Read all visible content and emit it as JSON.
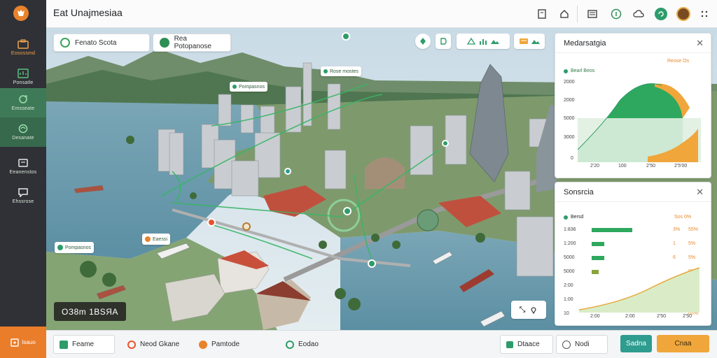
{
  "app": {
    "title": "Eat Unajmesiaa"
  },
  "sidebar": {
    "items": [
      {
        "label": "Eosossmd",
        "icon": "briefcase-icon"
      },
      {
        "label": "Ponsatle",
        "icon": "dashboard-icon"
      },
      {
        "label": "Emsseate",
        "icon": "refresh-icon"
      },
      {
        "label": "Desanate",
        "icon": "map-icon"
      },
      {
        "label": "Eeanenstos",
        "icon": "folder-icon"
      },
      {
        "label": "Ehssrose",
        "icon": "chat-icon"
      }
    ],
    "bottom_label": "Isauo"
  },
  "map": {
    "chip1": "Fenato Scota",
    "chip2": "Rea Potopanose",
    "coords": "ОЗ8m 1ВSЯA",
    "labels": [
      "Pompasnos",
      "Rose mostes",
      "Eaessi"
    ],
    "ctrl": "⤡"
  },
  "panel1": {
    "title": "Medarsatgia",
    "legend_left": "Bearl Beos",
    "legend_right": "Reose Os",
    "y_ticks": [
      "2000",
      "2000",
      "5000",
      "3000",
      "0"
    ],
    "x_ticks": [
      "2'20",
      "100",
      "2'50",
      "2'5'00"
    ]
  },
  "panel2": {
    "title": "Sonsrcia",
    "legend_left": "Bersd",
    "legend_right": "Sos 0%",
    "rows": [
      {
        "y": "1:836",
        "v1": "3%",
        "v2": "55%"
      },
      {
        "y": "1:200",
        "v1": "1",
        "v2": "5%"
      },
      {
        "y": "5000",
        "v1": "6",
        "v2": "5%"
      },
      {
        "y": "5000",
        "v1": "",
        "v2": "0%"
      },
      {
        "y": "2:00",
        "v1": "",
        "v2": "15%"
      },
      {
        "y": "1:00",
        "v1": "",
        "v2": "15%"
      },
      {
        "y": "10",
        "v1": "",
        "v2": "05%"
      }
    ],
    "x_ticks": [
      "2:00",
      "2:00",
      "2'50",
      "2'50"
    ]
  },
  "bottom": {
    "tabs": [
      "Feame",
      "Neod Gkane",
      "Pamtode",
      "Eodao"
    ],
    "filter1": "Dtaace",
    "filter2": "Nodi",
    "btn_primary": "Sadna",
    "btn_secondary": "Cnaa"
  },
  "colors": {
    "accent": "#e8832c",
    "green": "#3aa35f",
    "teal": "#2e9c8f",
    "orange": "#f0a63b",
    "sidebar": "#2f3136"
  }
}
